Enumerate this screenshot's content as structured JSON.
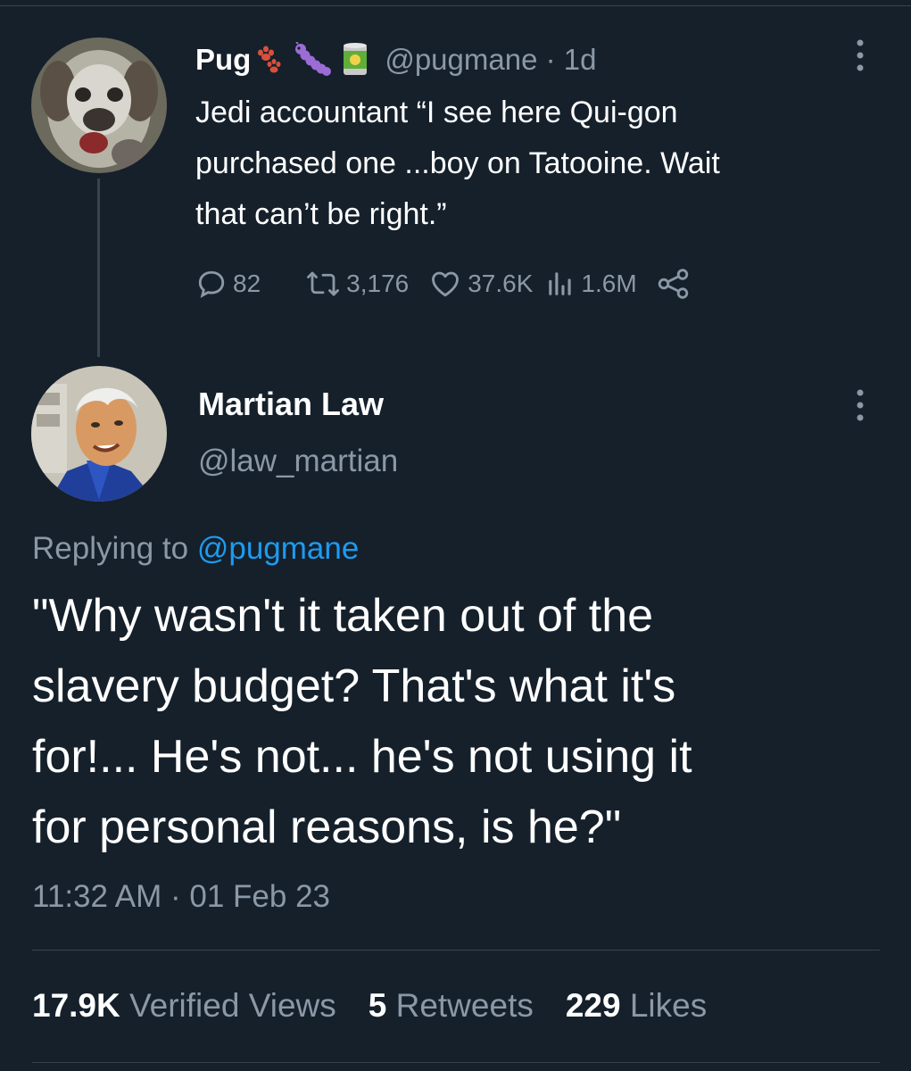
{
  "colors": {
    "background": "#15202b",
    "primary_text": "#ffffff",
    "secondary_text": "#8b98a5",
    "link": "#1d9bf0",
    "divider": "#38444d"
  },
  "parent_tweet": {
    "author_name": "Pug",
    "name_emojis": [
      "paw-prints-icon",
      "caterpillar-icon",
      "can-icon"
    ],
    "handle": "@pugmane",
    "age": "· 1d",
    "text": "Jedi accountant “I see here Qui-gon\npurchased one ...boy on Tatooine. Wait\nthat can’t be right.”",
    "actions": {
      "replies": "82",
      "retweets": "3,176",
      "likes": "37.6K",
      "views": "1.6M"
    },
    "icons": {
      "reply": "speech-bubble-icon",
      "retweet": "retweet-arrows-icon",
      "like": "heart-icon",
      "views": "bar-chart-icon",
      "share": "share-nodes-icon",
      "more": "more-vertical-icon"
    }
  },
  "reply_tweet": {
    "author_name": "Martian Law",
    "handle": "@law_martian",
    "replying_to_label": "Replying to",
    "replying_to_handle": "@pugmane",
    "text": "\"Why wasn't it taken out of the\nslavery budget? That's what it's\nfor!... He's not... he's not using it\nfor personal reasons, is he?\"",
    "timestamp": "11:32 AM · 01 Feb 23",
    "stats": {
      "views_count": "17.9K",
      "views_label": "Verified Views",
      "retweets_count": "5",
      "retweets_label": "Retweets",
      "likes_count": "229",
      "likes_label": "Likes"
    }
  }
}
